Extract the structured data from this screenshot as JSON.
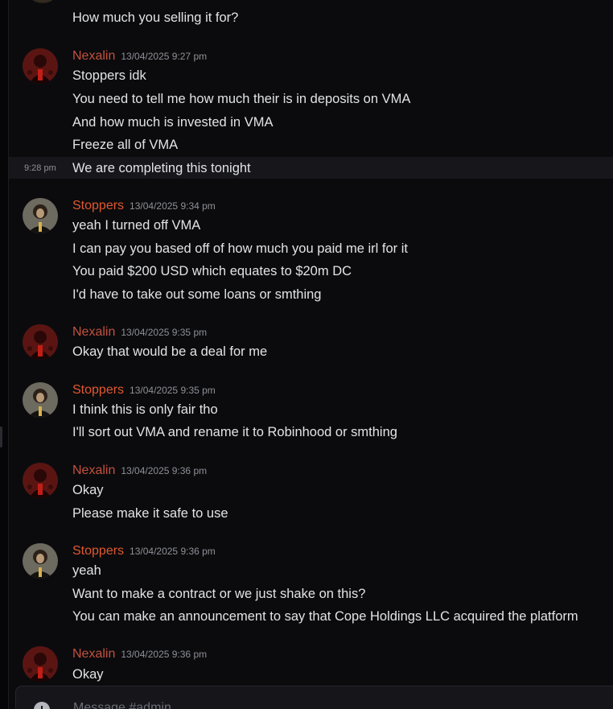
{
  "prior": {
    "lines": [
      "How much you selling it for?"
    ]
  },
  "hover_timestamp": "9:28 pm",
  "groups": [
    {
      "author": "Nexalin",
      "timestamp": "13/04/2025 9:27 pm",
      "lines": [
        "Stoppers idk",
        "You need to tell me how much their is in deposits on VMA",
        "And how much is invested in VMA",
        "Freeze all of VMA",
        "We are completing this tonight"
      ]
    },
    {
      "author": "Stoppers",
      "timestamp": "13/04/2025 9:34 pm",
      "lines": [
        "yeah I turned off VMA",
        "I can pay you based off of how much you paid me irl for it",
        "You paid $200 USD which equates to $20m DC",
        "I'd have to take out some loans or smthing"
      ]
    },
    {
      "author": "Nexalin",
      "timestamp": "13/04/2025 9:35 pm",
      "lines": [
        "Okay that would be a deal for me"
      ]
    },
    {
      "author": "Stoppers",
      "timestamp": "13/04/2025 9:35 pm",
      "lines": [
        "I think this is only fair tho",
        "I'll sort out VMA and rename it to Robinhood or smthing"
      ]
    },
    {
      "author": "Nexalin",
      "timestamp": "13/04/2025 9:36 pm",
      "lines": [
        "Okay",
        "Please make it safe to use"
      ]
    },
    {
      "author": "Stoppers",
      "timestamp": "13/04/2025 9:36 pm",
      "lines": [
        "yeah",
        "Want to make a contract or we just shake on this?",
        "You can make an announcement to say that Cope Holdings LLC acquired the platform"
      ]
    },
    {
      "author": "Nexalin",
      "timestamp": "13/04/2025 9:36 pm",
      "lines": [
        "Okay"
      ]
    }
  ],
  "composer": {
    "placeholder": "Message #admin"
  }
}
